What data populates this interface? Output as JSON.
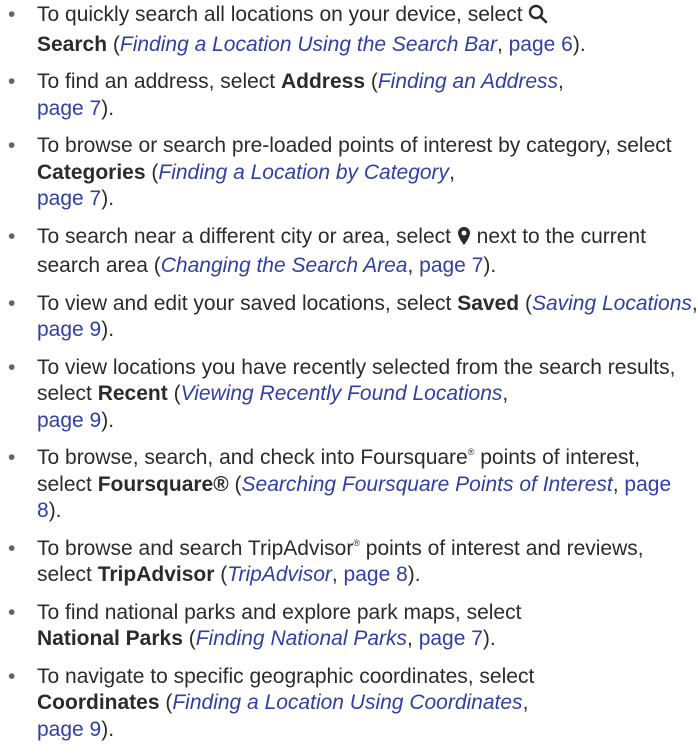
{
  "items": [
    {
      "pre": "To quickly search all locations on your device, select ",
      "bold": "Search",
      "link_title": "Finding a Location Using the Search Bar",
      "page": "page 6"
    },
    {
      "pre": "To find an address, select ",
      "bold": "Address",
      "link_title": "Finding an Address",
      "page": "page 7"
    },
    {
      "pre": "To browse or search pre-loaded points of interest by category, select ",
      "bold": "Categories",
      "link_title": "Finding a Location by Category",
      "page": "page 7"
    },
    {
      "pre": "To search near a different city or area, select ",
      "post": " next to the current search area",
      "link_title": "Changing the Search Area",
      "page": "page 7"
    },
    {
      "pre": "To view and edit your saved locations, select ",
      "bold": "Saved",
      "link_title": "Saving Locations",
      "page": "page 9"
    },
    {
      "pre": "To view locations you have recently selected from the search results, select ",
      "bold": "Recent",
      "link_title": "Viewing Recently Found Locations",
      "page": "page 9"
    },
    {
      "pre": "To browse, search, and check into Foursquare",
      "mark": "®",
      "pre2": " points of interest, select ",
      "bold": "Foursquare®",
      "link_title": "Searching Foursquare Points of Interest",
      "page": "page 8"
    },
    {
      "pre": "To browse and search TripAdvisor",
      "mark": "®",
      "pre2": " points of interest and reviews, select ",
      "bold": "TripAdvisor",
      "link_title": "TripAdvisor",
      "page": "page 8"
    },
    {
      "pre": "To find national parks and explore park maps, select ",
      "bold": "National Parks",
      "link_title": "Finding National Parks",
      "page": "page 7"
    },
    {
      "pre": "To navigate to specific geographic coordinates, select ",
      "bold": "Coordinates",
      "link_title": "Finding a Location Using Coordinates",
      "page": "page 9"
    }
  ],
  "icons": {
    "search": "search-icon",
    "location_pin": "location-pin-icon"
  },
  "colors": {
    "text": "#2b2b2b",
    "link": "#2f3fa6"
  },
  "punct": {
    "bullet": "•",
    "open": " (",
    "comma": ", ",
    "close": ")."
  }
}
